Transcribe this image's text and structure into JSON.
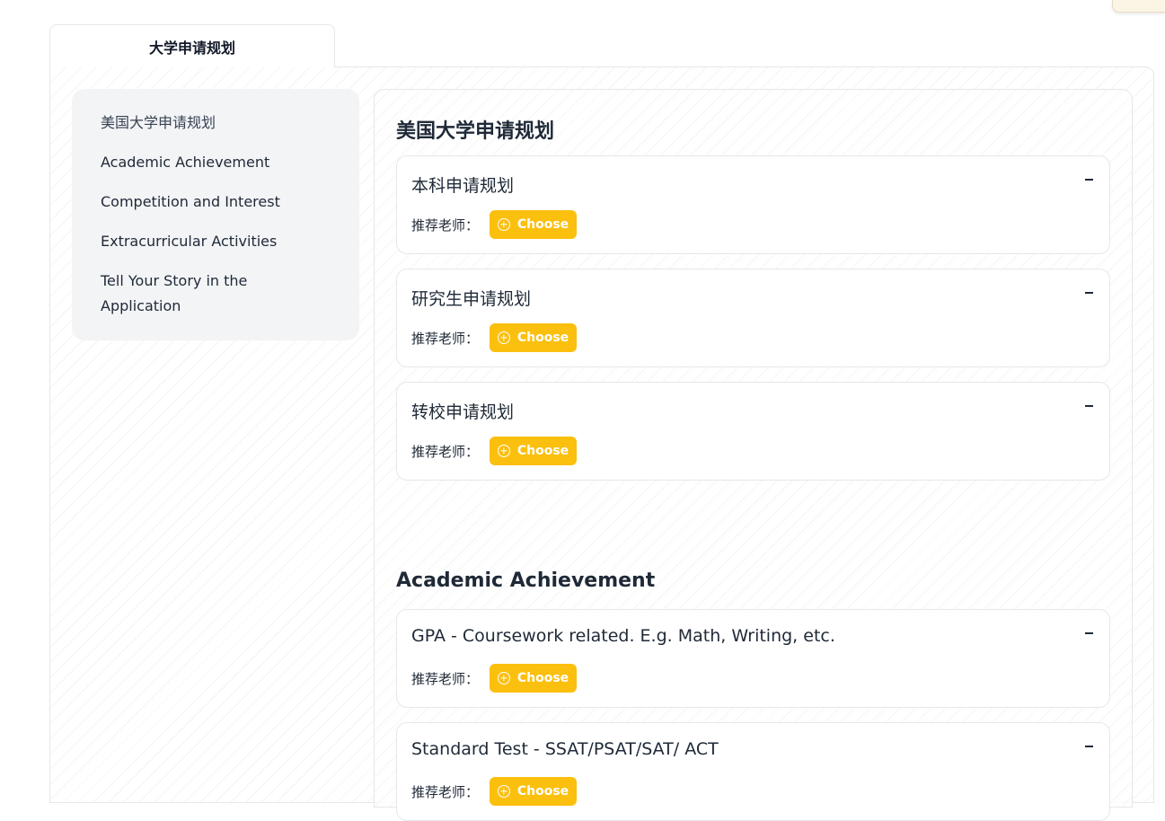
{
  "tab": {
    "label": "大学申请规划"
  },
  "sidebar": {
    "items": [
      {
        "label": "美国大学申请规划"
      },
      {
        "label": "Academic Achievement"
      },
      {
        "label": "Competition and Interest"
      },
      {
        "label": "Extracurricular Activities"
      },
      {
        "label": "Tell Your Story in the Application"
      }
    ]
  },
  "sections": [
    {
      "title": "美国大学申请规划",
      "cards": [
        {
          "title": "本科申请规划",
          "teacher_label": "推荐老师：",
          "button": "Choose"
        },
        {
          "title": "研究生申请规划",
          "teacher_label": "推荐老师：",
          "button": "Choose"
        },
        {
          "title": "转校申请规划",
          "teacher_label": "推荐老师：",
          "button": "Choose"
        }
      ]
    },
    {
      "title": "Academic Achievement",
      "cards": [
        {
          "title": "GPA - Coursework related. E.g. Math, Writing, etc.",
          "teacher_label": "推荐老师：",
          "button": "Choose"
        },
        {
          "title": "Standard Test - SSAT/PSAT/SAT/ ACT",
          "teacher_label": "推荐老师：",
          "button": "Choose"
        }
      ]
    }
  ],
  "colors": {
    "accent": "#fbbf0e",
    "sidebar_bg": "#f3f4f6",
    "border": "#e5e7eb",
    "text": "#1f2937"
  },
  "icons": {
    "card_toggle": "minus-icon",
    "choose_button": "plus-circle-icon"
  }
}
